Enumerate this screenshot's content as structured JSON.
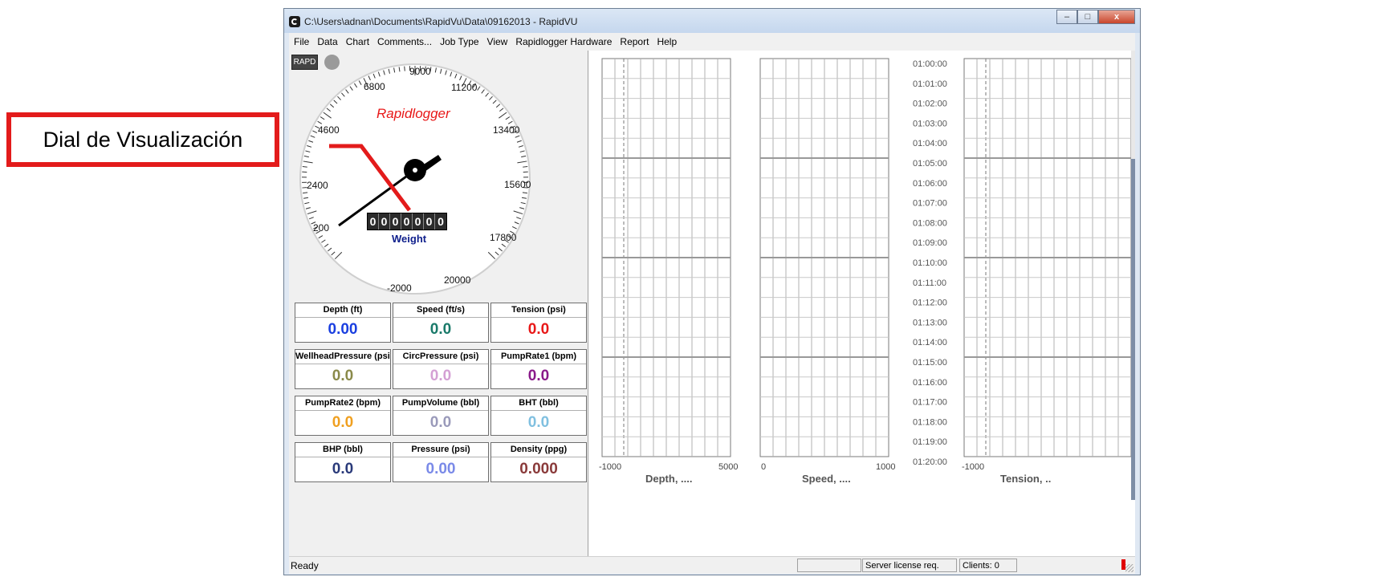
{
  "window": {
    "title": "C:\\Users\\adnan\\Documents\\RapidVu\\Data\\09162013 - RapidVU",
    "minimize": "–",
    "maximize": "□",
    "close": "x"
  },
  "menu": [
    "File",
    "Data",
    "Chart",
    "Comments...",
    "Job Type",
    "View",
    "Rapidlogger Hardware",
    "Report",
    "Help"
  ],
  "toolbar": {
    "rapd": "RAPD"
  },
  "gauge": {
    "brand": "Rapidlogger",
    "ticks": [
      "-2000",
      "200",
      "2400",
      "4600",
      "6800",
      "9000",
      "11200",
      "13400",
      "15600",
      "17800",
      "20000"
    ],
    "odometer": [
      "0",
      "0",
      "0",
      "0",
      "0",
      "0",
      "0"
    ],
    "label": "Weight"
  },
  "readouts": [
    {
      "label": "Depth (ft)",
      "value": "0.00",
      "color": "#1a3fe0"
    },
    {
      "label": "Speed (ft/s)",
      "value": "0.0",
      "color": "#1a7a6a"
    },
    {
      "label": "Tension (psi)",
      "value": "0.0",
      "color": "#e81818"
    },
    {
      "label": "WellheadPressure (psi)",
      "value": "0.0",
      "color": "#8a8a4a"
    },
    {
      "label": "CircPressure (psi)",
      "value": "0.0",
      "color": "#d4a0d4"
    },
    {
      "label": "PumpRate1 (bpm)",
      "value": "0.0",
      "color": "#8a1a8a"
    },
    {
      "label": "PumpRate2 (bpm)",
      "value": "0.0",
      "color": "#f0a020"
    },
    {
      "label": "PumpVolume (bbl)",
      "value": "0.0",
      "color": "#9a9aba"
    },
    {
      "label": "BHT (bbl)",
      "value": "0.0",
      "color": "#80c0e0"
    },
    {
      "label": "BHP (bbl)",
      "value": "0.0",
      "color": "#2a3a7a"
    },
    {
      "label": "Pressure (psi)",
      "value": "0.00",
      "color": "#7a8ae8"
    },
    {
      "label": "Density (ppg)",
      "value": "0.000",
      "color": "#8a3a3a"
    }
  ],
  "chart_data": {
    "type": "line",
    "time_axis": [
      "01:00:00",
      "01:01:00",
      "01:02:00",
      "01:03:00",
      "01:04:00",
      "01:05:00",
      "01:06:00",
      "01:07:00",
      "01:08:00",
      "01:09:00",
      "01:10:00",
      "01:11:00",
      "01:12:00",
      "01:13:00",
      "01:14:00",
      "01:15:00",
      "01:16:00",
      "01:17:00",
      "01:18:00",
      "01:19:00",
      "01:20:00"
    ],
    "tracks": [
      {
        "label": "Depth, ....",
        "min": "-1000",
        "max": "5000"
      },
      {
        "label": "Speed, ....",
        "min": "0",
        "max": "1000"
      },
      {
        "label": "Tension, ..",
        "min": "-1000",
        "max": ""
      }
    ],
    "grid": true
  },
  "status": {
    "ready": "Ready",
    "license": "Server license req.",
    "clients": "Clients: 0"
  },
  "callout": {
    "text": "Dial de Visualización",
    "color": "#e31b1b"
  }
}
